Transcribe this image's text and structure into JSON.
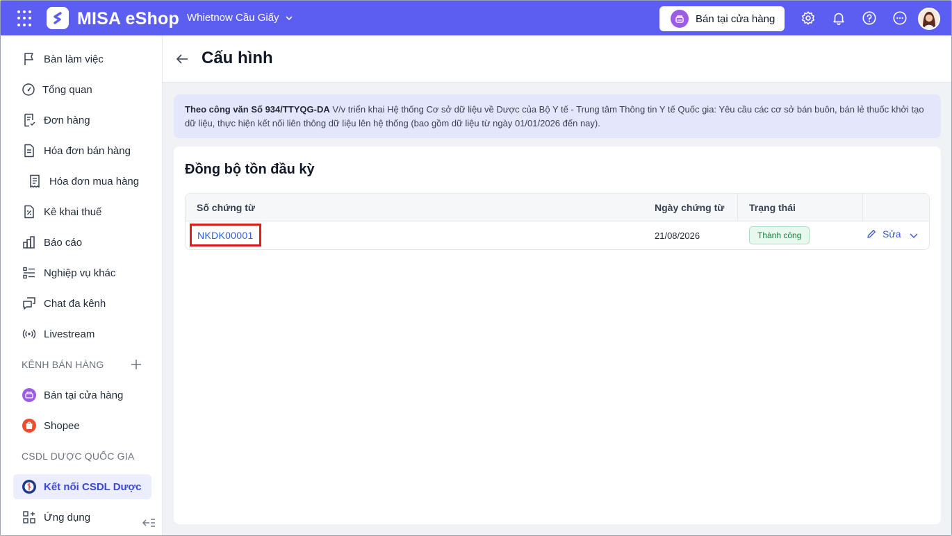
{
  "topbar": {
    "brand": "MISA eShop",
    "store_name": "Whietnow Cầu Giấy",
    "sell_button": "Bán tại cửa hàng",
    "accent_color": "#5b5ef0"
  },
  "sidebar": {
    "items": [
      {
        "label": "Bàn làm việc",
        "icon": "flag-icon"
      },
      {
        "label": "Tổng quan",
        "icon": "gauge-icon"
      },
      {
        "label": "Đơn hàng",
        "icon": "order-icon"
      },
      {
        "label": "Hóa đơn bán hàng",
        "icon": "invoice-icon"
      },
      {
        "label": "Hóa đơn mua hàng",
        "icon": "receipt-icon"
      },
      {
        "label": "Kê khai thuế",
        "icon": "tax-icon"
      },
      {
        "label": "Báo cáo",
        "icon": "report-icon"
      },
      {
        "label": "Nghiệp vụ khác",
        "icon": "list-icon"
      },
      {
        "label": "Chat đa kênh",
        "icon": "chat-icon"
      },
      {
        "label": "Livestream",
        "icon": "livestream-icon"
      }
    ],
    "section_channels": "KÊNH BÁN HÀNG",
    "channels": [
      {
        "label": "Bán tại cửa hàng",
        "icon": "store-icon"
      },
      {
        "label": "Shopee",
        "icon": "shopee-icon"
      }
    ],
    "section_csdl": "CSDL DƯỢC QUỐC GIA",
    "csdl_item": "Kết nối CSDL Dược",
    "apps_item": "Ứng dụng"
  },
  "main": {
    "page_title": "Cấu hình",
    "notice_bold": "Theo công văn Số 934/TTYQG-DA",
    "notice_text": " V/v triển khai Hệ thống Cơ sở dữ liệu về Dược của Bộ Y tế - Trung tâm Thông tin Y tế Quốc gia: Yêu cầu các cơ sở bán buôn, bán lẻ thuốc khởi tạo dữ liệu, thực hiện kết nối liên thông dữ liệu lên hệ thống (bao gồm dữ liệu từ ngày 01/01/2026 đến nay).",
    "card_title": "Đồng bộ tồn đầu kỳ",
    "table": {
      "headers": [
        "Số chứng từ",
        "Ngày chứng từ",
        "Trạng thái"
      ],
      "rows": [
        {
          "doc_no": "NKDK00001",
          "date": "21/08/2026",
          "status": "Thành công",
          "action": "Sửa"
        }
      ]
    }
  }
}
